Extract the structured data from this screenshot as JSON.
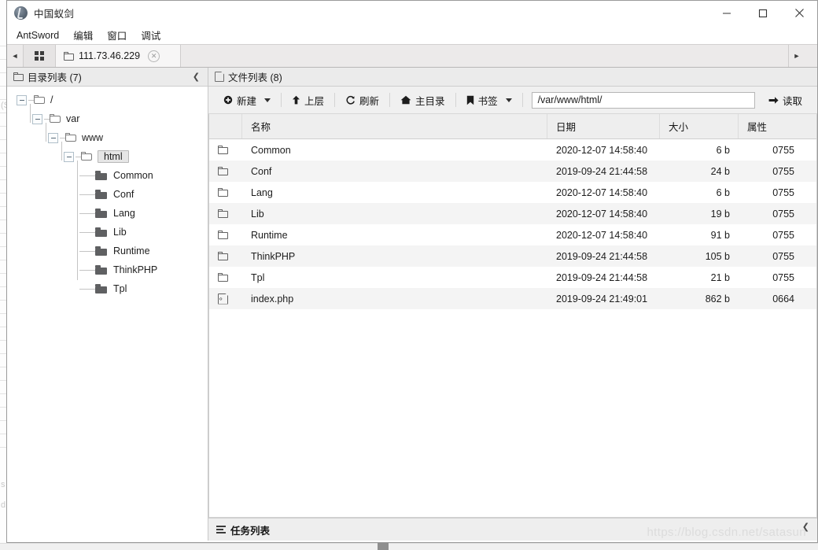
{
  "window": {
    "title": "中国蚁剑",
    "logo_icon": "antsword-logo-icon",
    "controls": {
      "minimize": "minimize-icon",
      "maximize": "maximize-icon",
      "close": "close-icon"
    }
  },
  "menubar": {
    "items": [
      {
        "label": "AntSword"
      },
      {
        "label": "编辑"
      },
      {
        "label": "窗口"
      },
      {
        "label": "调试"
      }
    ]
  },
  "tabstrip": {
    "left_arrow_icon": "chevron-left-icon",
    "right_arrow_icon": "chevron-right-icon",
    "grid_button_icon": "grid-view-icon",
    "tabs": [
      {
        "label": "111.73.46.229",
        "icon": "folder-icon",
        "close_icon": "close-circle-icon",
        "active": true
      }
    ]
  },
  "left_panel": {
    "header": {
      "icon": "folder-icon",
      "title": "目录列表 (7)",
      "collapse_icon": "chevron-left-icon"
    },
    "tree": [
      {
        "label": "/",
        "depth": 0,
        "type": "open-folder",
        "expanded": true,
        "selected": false
      },
      {
        "label": "var",
        "depth": 1,
        "type": "open-folder",
        "expanded": true,
        "selected": false
      },
      {
        "label": "www",
        "depth": 2,
        "type": "open-folder",
        "expanded": true,
        "selected": false
      },
      {
        "label": "html",
        "depth": 3,
        "type": "open-folder",
        "expanded": true,
        "selected": true
      },
      {
        "label": "Common",
        "depth": 4,
        "type": "solid-folder",
        "expanded": false,
        "selected": false
      },
      {
        "label": "Conf",
        "depth": 4,
        "type": "solid-folder",
        "expanded": false,
        "selected": false
      },
      {
        "label": "Lang",
        "depth": 4,
        "type": "solid-folder",
        "expanded": false,
        "selected": false
      },
      {
        "label": "Lib",
        "depth": 4,
        "type": "solid-folder",
        "expanded": false,
        "selected": false
      },
      {
        "label": "Runtime",
        "depth": 4,
        "type": "solid-folder",
        "expanded": false,
        "selected": false
      },
      {
        "label": "ThinkPHP",
        "depth": 4,
        "type": "solid-folder",
        "expanded": false,
        "selected": false
      },
      {
        "label": "Tpl",
        "depth": 4,
        "type": "solid-folder",
        "expanded": false,
        "selected": false
      }
    ]
  },
  "right_panel": {
    "header": {
      "icon": "file-icon",
      "title": "文件列表 (8)",
      "collapse_icon": "chevron-up-icon"
    },
    "toolbar": {
      "new_label": "新建",
      "new_icon": "plus-circle-icon",
      "new_has_dropdown": true,
      "up_label": "上层",
      "up_icon": "arrow-up-icon",
      "refresh_label": "刷新",
      "refresh_icon": "refresh-icon",
      "home_label": "主目录",
      "home_icon": "home-icon",
      "bookmark_label": "书签",
      "bookmark_icon": "bookmark-icon",
      "bookmark_has_dropdown": true,
      "path_value": "/var/www/html/",
      "path_placeholder": "/var/www/html/",
      "read_label": "读取",
      "read_icon": "arrow-right-icon"
    },
    "table": {
      "columns": [
        "",
        "名称",
        "日期",
        "大小",
        "属性"
      ],
      "rows": [
        {
          "icon": "folder-icon",
          "name": "Common",
          "date": "2020-12-07 14:58:40",
          "size": "6 b",
          "attr": "0755"
        },
        {
          "icon": "folder-icon",
          "name": "Conf",
          "date": "2019-09-24 21:44:58",
          "size": "24 b",
          "attr": "0755"
        },
        {
          "icon": "folder-icon",
          "name": "Lang",
          "date": "2020-12-07 14:58:40",
          "size": "6 b",
          "attr": "0755"
        },
        {
          "icon": "folder-icon",
          "name": "Lib",
          "date": "2020-12-07 14:58:40",
          "size": "19 b",
          "attr": "0755"
        },
        {
          "icon": "folder-icon",
          "name": "Runtime",
          "date": "2020-12-07 14:58:40",
          "size": "91 b",
          "attr": "0755"
        },
        {
          "icon": "folder-icon",
          "name": "ThinkPHP",
          "date": "2019-09-24 21:44:58",
          "size": "105 b",
          "attr": "0755"
        },
        {
          "icon": "folder-icon",
          "name": "Tpl",
          "date": "2019-09-24 21:44:58",
          "size": "21 b",
          "attr": "0755"
        },
        {
          "icon": "php-file-icon",
          "name": "index.php",
          "date": "2019-09-24 21:49:01",
          "size": "862 b",
          "attr": "0664"
        }
      ]
    }
  },
  "statusbar": {
    "icon": "task-list-icon",
    "label": "任务列表",
    "expand_icon": "chevron-up-icon",
    "watermark": "https://blog.csdn.net/satasun"
  },
  "colors": {
    "window_chrome": "#f0f0f0",
    "panel_header": "#ebebeb",
    "tab_active": "#f7f6f6",
    "tab_strip": "#eceaea",
    "row_alt": "#f4f4f4",
    "border": "#d0d0d0",
    "text": "#1a1a1a"
  }
}
